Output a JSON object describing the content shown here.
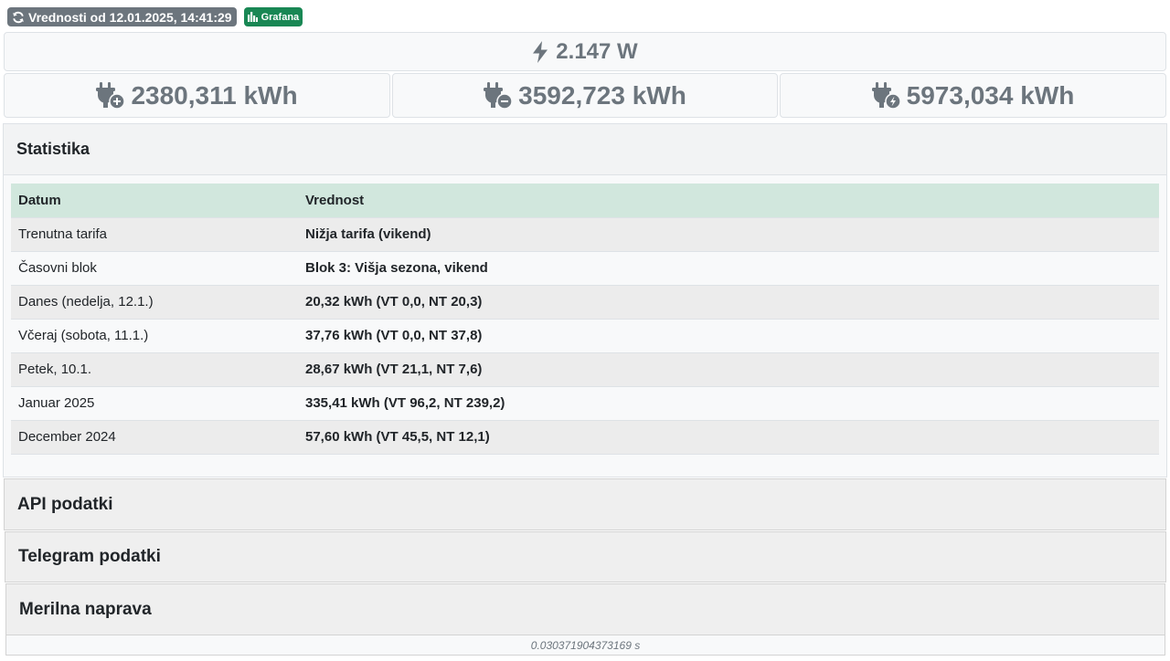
{
  "header": {
    "refresh_label": "Vrednosti od 12.01.2025, 14:41:29",
    "grafana_label": "Grafana"
  },
  "power": {
    "value": "2.147 W"
  },
  "energy": {
    "import": "2380,311 kWh",
    "export": "3592,723 kWh",
    "total": "5973,034 kWh"
  },
  "statistics": {
    "title": "Statistika",
    "columns": [
      "Datum",
      "Vrednost"
    ],
    "rows": [
      {
        "label": "Trenutna tarifa",
        "value": "Nižja tarifa (vikend)"
      },
      {
        "label": "Časovni blok",
        "value": "Blok 3: Višja sezona, vikend"
      },
      {
        "label": "Danes (nedelja, 12.1.)",
        "value": "20,32 kWh (VT 0,0, NT 20,3)"
      },
      {
        "label": "Včeraj (sobota, 11.1.)",
        "value": "37,76 kWh (VT 0,0, NT 37,8)"
      },
      {
        "label": "Petek, 10.1.",
        "value": "28,67 kWh (VT 21,1, NT 7,6)"
      },
      {
        "label": "Januar 2025",
        "value": "335,41 kWh (VT 96,2, NT 239,2)"
      },
      {
        "label": "December 2024",
        "value": "57,60 kWh (VT 45,5, NT 12,1)"
      }
    ]
  },
  "sections": {
    "api": "API podatki",
    "telegram": "Telegram podatki",
    "meter": "Merilna naprava"
  },
  "footer": {
    "timing": "0.030371904373169 s"
  },
  "icons": {
    "refresh": "refresh-icon",
    "grafana": "bar-chart-icon",
    "power": "bolt-icon",
    "import": "plug-plus-icon",
    "export": "plug-minus-icon",
    "total": "plug-bolt-icon"
  },
  "colors": {
    "badge_gray": "#6c757d",
    "badge_green": "#198754",
    "table_header": "#d1e7dd",
    "muted_text": "#6c757d"
  }
}
